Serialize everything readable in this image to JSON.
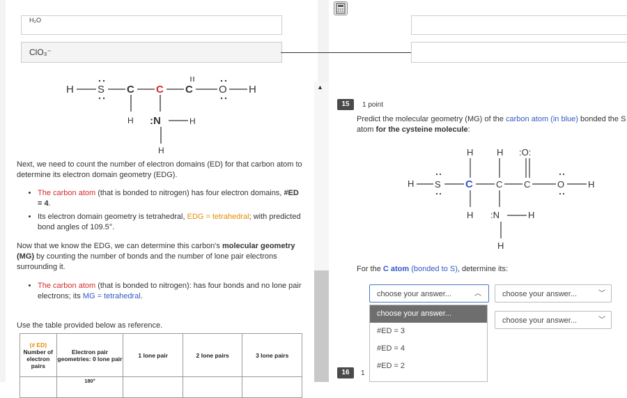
{
  "top_rows": {
    "row1_label": "H₂O",
    "row2_label": "ClO₃⁻"
  },
  "left_molecule": {
    "atoms": {
      "h_left": "H",
      "s": "S",
      "c1": "C",
      "c2": "C",
      "c3": "C",
      "o": "O",
      "h_right": "H",
      "h_mid": "H",
      "n": ":N",
      "h_n": "H",
      "h_bottom": "H"
    }
  },
  "explanation": {
    "intro": "Next, we need to count the number of electron domains (ED) for that carbon atom to determine its electron domain geometry (EDG).",
    "bullet1_red": "The carbon atom",
    "bullet1_rest": " (that is bonded to nitrogen) has four electron domains, ",
    "bullet1_bold": "#ED = 4",
    "bullet1_end": ".",
    "bullet2_start": "Its electron domain geometry is tetrahedral, ",
    "bullet2_orange": "EDG = tetrahedral",
    "bullet2_end": "; with predicted bond angles of 109.5°.",
    "para2_start": "Now that we know the EDG, we can determine this carbon's ",
    "para2_bold1": "molecular geometry (MG)",
    "para2_rest": " by counting the number of bonds and the number of lone pair electrons surrounding it.",
    "bullet3_red": "The carbon atom",
    "bullet3_rest": " (that is bonded to nitrogen): has four bonds and no lone pair electrons; its ",
    "bullet3_blue": "MG = tetrahedral",
    "bullet3_end": ".",
    "table_intro": "Use the table provided below as reference."
  },
  "ref_table": {
    "col1_orange": "(# ED)",
    "col1": "Number of electron pairs",
    "col2": "Electron pair geometries: 0 lone pair",
    "col3": "1 lone pair",
    "col4": "2 lone pairs",
    "col5": "3 lone pairs",
    "angle": "180°"
  },
  "question15": {
    "number": "15",
    "points": "1 point",
    "prompt_start": "Predict the molecular geometry (MG) of the ",
    "prompt_blue": "carbon atom (in blue)",
    "prompt_mid": " bonded the S atom ",
    "prompt_bold": "for the cysteine molecule",
    "prompt_end": ":",
    "for_start": "For the ",
    "for_blue1": "C atom",
    "for_blue2": " (bonded to S)",
    "for_end": ", determine its:",
    "select1_value": "choose your answer...",
    "select2_value": "choose your answer...",
    "select3_value": "choose your answer...",
    "dropdown_options": [
      "choose your answer...",
      "#ED = 3",
      "#ED = 4",
      "#ED = 2"
    ]
  },
  "right_molecule": {
    "atoms": {
      "h1": "H",
      "h2": "H",
      "o_top": ":O:",
      "h_left": "H",
      "s": "S",
      "c_blue": "C",
      "c2": "C",
      "c3": "C",
      "o": "O",
      "h_right": "H",
      "h_under": "H",
      "n": ":N",
      "h_n": "H",
      "h_bottom": "H"
    }
  },
  "question16": {
    "number": "16",
    "points": "1"
  },
  "colors": {
    "accent_blue": "#3458c4",
    "red": "#d42a2a",
    "orange": "#e58a00"
  }
}
